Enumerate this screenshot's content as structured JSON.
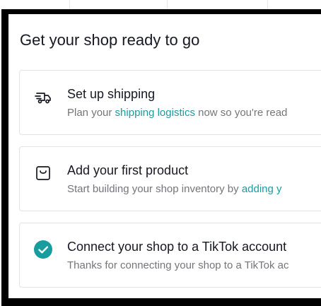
{
  "panel": {
    "title": "Get your shop ready to go"
  },
  "tasks": [
    {
      "icon": "delivery-truck-icon",
      "title": "Set up shipping",
      "desc_before": "Plan your ",
      "link": "shipping logistics",
      "desc_after": " now so you're read",
      "completed": false
    },
    {
      "icon": "shopping-bag-icon",
      "title": "Add your first product",
      "desc_before": "Start building your shop inventory by ",
      "link": "adding y",
      "desc_after": "",
      "completed": false
    },
    {
      "icon": "checkmark-circle-icon",
      "title": "Connect your shop to a TikTok account",
      "desc_before": "Thanks for connecting your shop to a TikTok ac",
      "link": "",
      "desc_after": "",
      "completed": true
    }
  ],
  "colors": {
    "accent": "#199c9d",
    "text": "#161823",
    "muted": "#73757b",
    "frame": "#000000"
  }
}
